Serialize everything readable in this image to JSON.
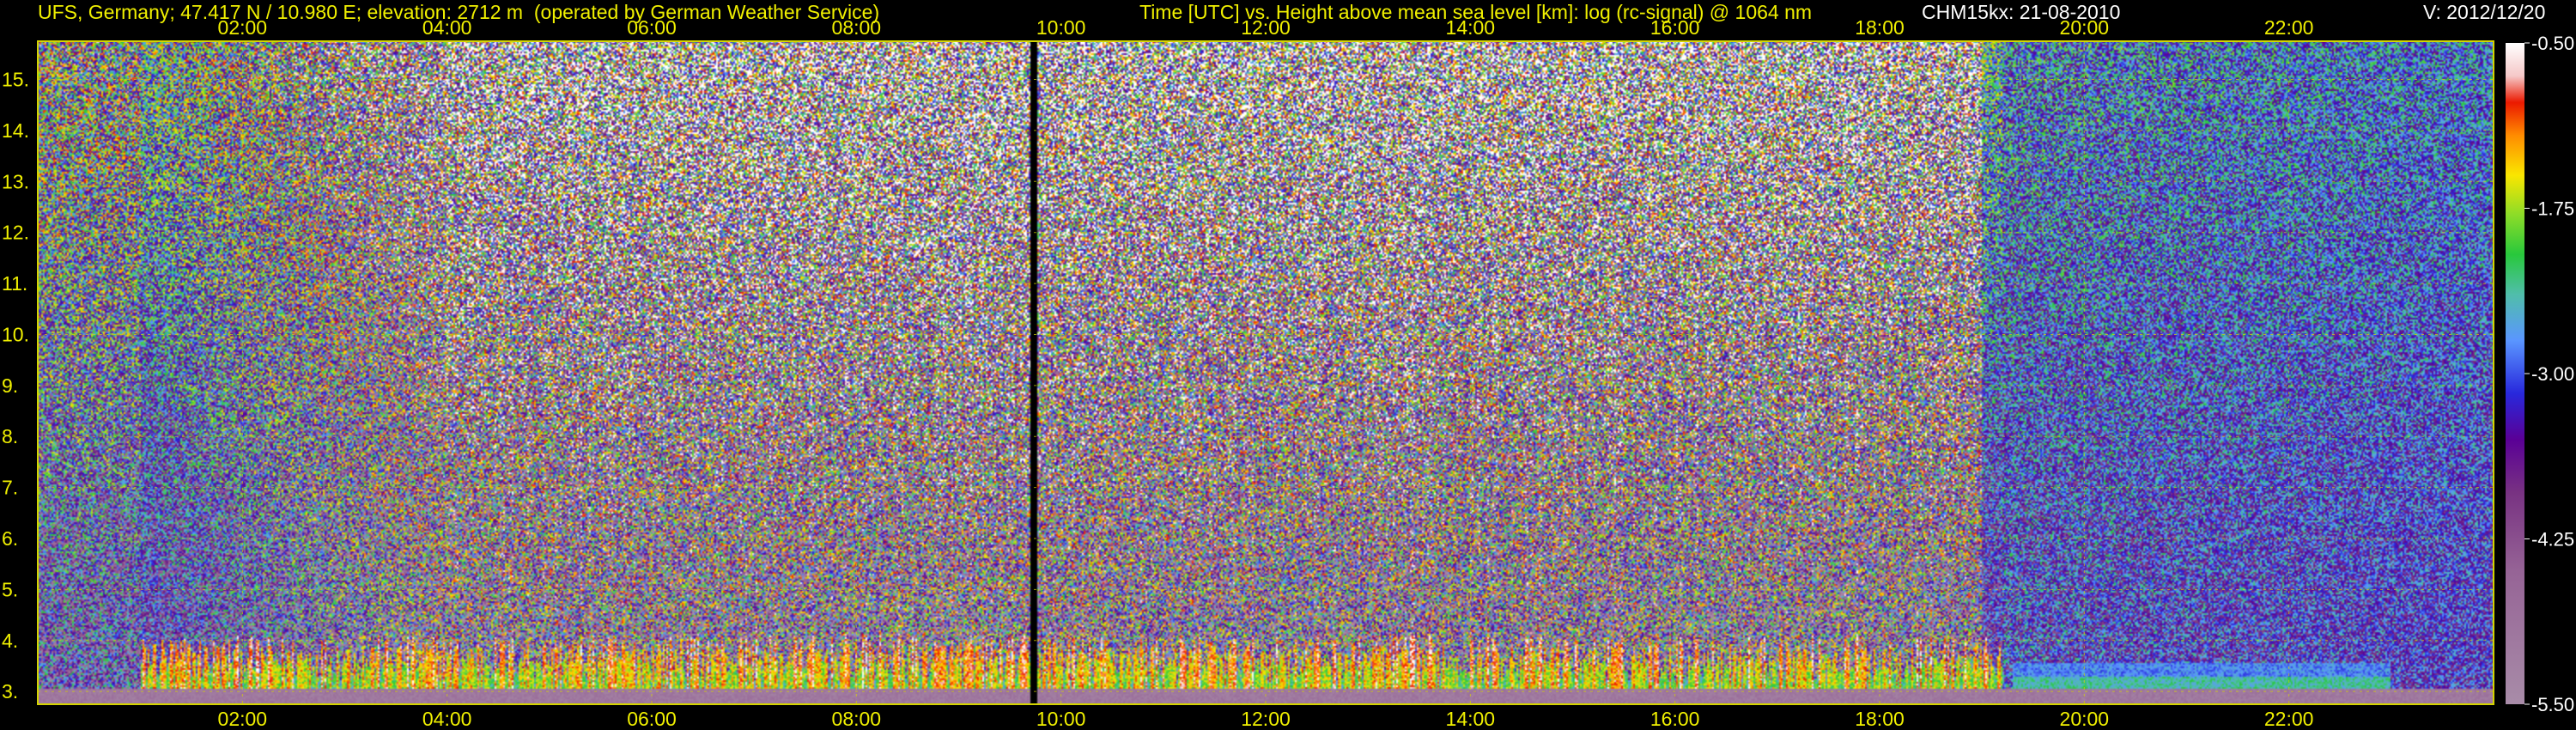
{
  "header": {
    "station": "UFS, Germany; 47.417 N / 10.980 E; elevation: 2712 m  (operated by German Weather Service)",
    "axes_desc": "Time [UTC] vs. Height above mean sea level [km]: log (rc-signal) @ 1064 nm",
    "instrument": "CHM15kx: 21-08-2010",
    "version": "V: 2012/12/20"
  },
  "colors": {
    "axis_text": "#f0f000",
    "grid": "#d4d400",
    "background": "#000000"
  },
  "chart_data": {
    "type": "heatmap",
    "x_range_hours": [
      0,
      24
    ],
    "x_ticks": [
      "02:00",
      "04:00",
      "06:00",
      "08:00",
      "10:00",
      "12:00",
      "14:00",
      "16:00",
      "18:00",
      "20:00",
      "22:00"
    ],
    "x_tick_hours": [
      2,
      4,
      6,
      8,
      10,
      12,
      14,
      16,
      18,
      20,
      22
    ],
    "y_range_km": [
      2.75,
      15.75
    ],
    "y_ticks": [
      "3.",
      "4.",
      "5.",
      "6.",
      "7.",
      "8.",
      "9.",
      "10.",
      "11.",
      "12.",
      "13.",
      "14.",
      "15."
    ],
    "y_tick_values": [
      3,
      4,
      5,
      6,
      7,
      8,
      9,
      10,
      11,
      12,
      13,
      14,
      15
    ],
    "grid": true,
    "colorbar": {
      "range": [
        -5.5,
        -0.5
      ],
      "tick_values": [
        -0.5,
        -1.75,
        -3.0,
        -4.25,
        -5.5
      ],
      "tick_labels": [
        "-0.50",
        "-1.75",
        "-3.00",
        "-4.25",
        "-5.50"
      ]
    },
    "data_gap_hour": 9.73
  }
}
